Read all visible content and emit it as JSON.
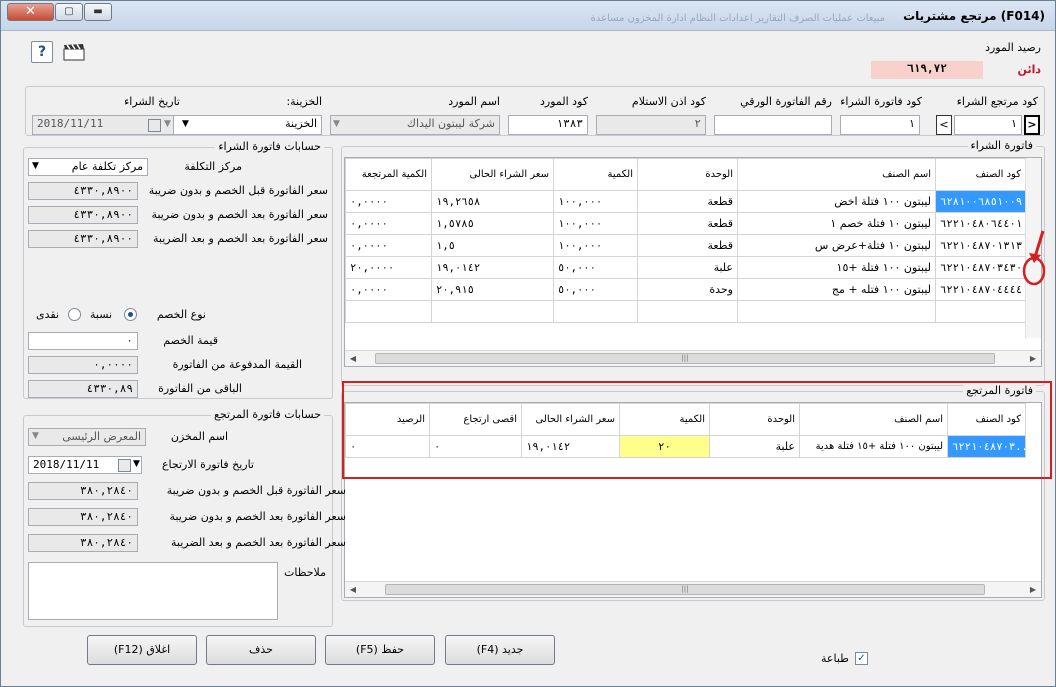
{
  "window": {
    "title": "(F014)  مرتجع مشتريات",
    "ghost_menu": "مبيعات   عمليات   الصرف   التقارير   اعدادات النظام   ادارة المخزون   مساعدة",
    "close_glyph": "✕",
    "max_glyph": "▢",
    "min_glyph": "▬"
  },
  "supplier_balance": {
    "label": "رصيد المورد",
    "value": "٦١٩,٧٢",
    "status": "دائن"
  },
  "header": {
    "return_code_label": "كود مرتجع الشراء",
    "return_code_value": "١",
    "nav_next": ">",
    "nav_prev": "<",
    "purchase_invoice_code_label": "كود فاتورة الشراء",
    "purchase_invoice_code_value": "١",
    "paper_invoice_label": "رقم الفاتورة الورقي",
    "paper_invoice_value": "",
    "receipt_code_label": "كود اذن الاستلام",
    "receipt_code_value": "٢",
    "supplier_code_label": "كود المورد",
    "supplier_code_value": "١٣٨٣",
    "supplier_name_label": "اسم المورد",
    "supplier_name_value": "شركة ليبتون اليداك",
    "treasury_label": "الخزينة:",
    "treasury_value": "الخزينة",
    "purchase_date_label": "تاريخ الشراء",
    "purchase_date_value": "2018/11/11"
  },
  "purchase_invoice": {
    "title": "فاتورة الشراء",
    "columns": [
      "كود الصنف",
      "اسم الصنف",
      "الوحدة",
      "الكمية",
      "سعر الشراء الحالى",
      "الكمية المرتجعة"
    ],
    "rows": [
      {
        "code": "٦٢٨١٠٠٦٨٥١٠٠٩",
        "name": "ليبتون ١٠٠ فتلة اخض",
        "unit": "قطعة",
        "qty": "١٠٠,٠٠٠",
        "price": "١٩,٢٦٥٨",
        "returned": "٠,٠٠٠٠"
      },
      {
        "code": "٦٢٢١٠٤٨٠٦٤٤٠١",
        "name": "ليبتون ١٠ فتلة خصم ١",
        "unit": "قطعة",
        "qty": "١٠٠,٠٠٠",
        "price": "١,٥٧٨٥",
        "returned": "٠,٠٠٠٠"
      },
      {
        "code": "٦٢٢١٠٤٨٧٠١٣١٣",
        "name": "ليبتون ١٠ فتلة+عرض س",
        "unit": "قطعة",
        "qty": "١٠٠,٠٠٠",
        "price": "١,٥",
        "returned": "٠,٠٠٠٠"
      },
      {
        "code": "٦٢٢١٠٤٨٧٠٣٤٣٠",
        "name": "ليبتون ١٠٠ فتلة +١٥",
        "unit": "علبة",
        "qty": "٥٠,٠٠٠",
        "price": "١٩,٠١٤٢",
        "returned": "٢٠,٠٠٠٠"
      },
      {
        "code": "٦٢٢١٠٤٨٧٠٤٤٤٤",
        "name": "ليبتون ١٠٠ فتله + مج",
        "unit": "وحدة",
        "qty": "٥٠,٠٠٠",
        "price": "٢٠,٩١٥",
        "returned": "٠,٠٠٠٠"
      }
    ]
  },
  "return_invoice": {
    "title": "فاتورة المرتجع",
    "columns": [
      "كود الصنف",
      "اسم الصنف",
      "الوحدة",
      "الكمية",
      "سعر الشراء الحالى",
      "اقصى ارتجاع",
      "الرصيد"
    ],
    "rows": [
      {
        "code": "٦٢٢١٠٤٨٧٠٣...",
        "name": "ليبتون ١٠٠ فتلة +١٥ فتلة هدية",
        "unit": "علبة",
        "qty": "٢٠",
        "price": "١٩,٠١٤٢",
        "max_return": "٠",
        "balance": "٠"
      }
    ]
  },
  "purchase_accounts": {
    "title": "حسابات فاتورة الشراء",
    "cost_center_label": "مركز التكلفة",
    "cost_center_value": "مركز تكلفة عام",
    "before_discount_label": "سعر الفاتورة قبل الخصم و بدون ضريبة",
    "before_discount_value": "٤٣٣٠,٨٩٠٠",
    "after_discount_label": "سعر الفاتورة بعد الخصم و بدون ضريبة",
    "after_discount_value": "٤٣٣٠,٨٩٠٠",
    "after_tax_label": "سعر الفاتورة بعد الخصم و بعد الضريبة",
    "after_tax_value": "٤٣٣٠,٨٩٠٠",
    "discount_type_label": "نوع الخصم",
    "discount_percent_label": "نسبة",
    "discount_cash_label": "نقدى",
    "discount_value_label": "قيمة الخصم",
    "discount_value": "٠",
    "paid_label": "القيمة المدفوعة من الفاتورة",
    "paid_value": "٠,٠٠٠٠",
    "remaining_label": "الباقى من الفاتورة",
    "remaining_value": "٤٣٣٠,٨٩"
  },
  "return_accounts": {
    "title": "حسابات فاتورة المرتجع",
    "store_label": "اسم المخزن",
    "store_value": "المعرض الرئيسى",
    "return_date_label": "تاريخ فاتورة الارتجاع",
    "return_date_value": "2018/11/11",
    "before_discount_label": "سعر الفاتورة قبل الخصم و بدون ضريبة",
    "before_discount_value": "٣٨٠,٢٨٤٠",
    "after_discount_label": "سعر الفاتورة بعد الخصم و بدون ضريبة",
    "after_discount_value": "٣٨٠,٢٨٤٠",
    "after_tax_label": "سعر الفاتورة بعد الخصم و بعد الضريبة",
    "after_tax_value": "٣٨٠,٢٨٤٠",
    "notes_label": "ملاحظات"
  },
  "footer": {
    "print_label": "طباعة",
    "new_button": "جديد (F4)",
    "save_button": "حفظ (F5)",
    "delete_button": "حذف",
    "close_button": "اغلاق (F12)"
  },
  "icons": {
    "help": "?",
    "dropdown": "▼",
    "check": "✓",
    "scroll_left": "◀",
    "scroll_right": "▶",
    "scroll_grip": "|||"
  },
  "colors": {
    "selection": "#3399ff",
    "highlight": "#ffff8c",
    "annotation_red": "#d32020",
    "balance_bg": "#f8d0cc"
  }
}
